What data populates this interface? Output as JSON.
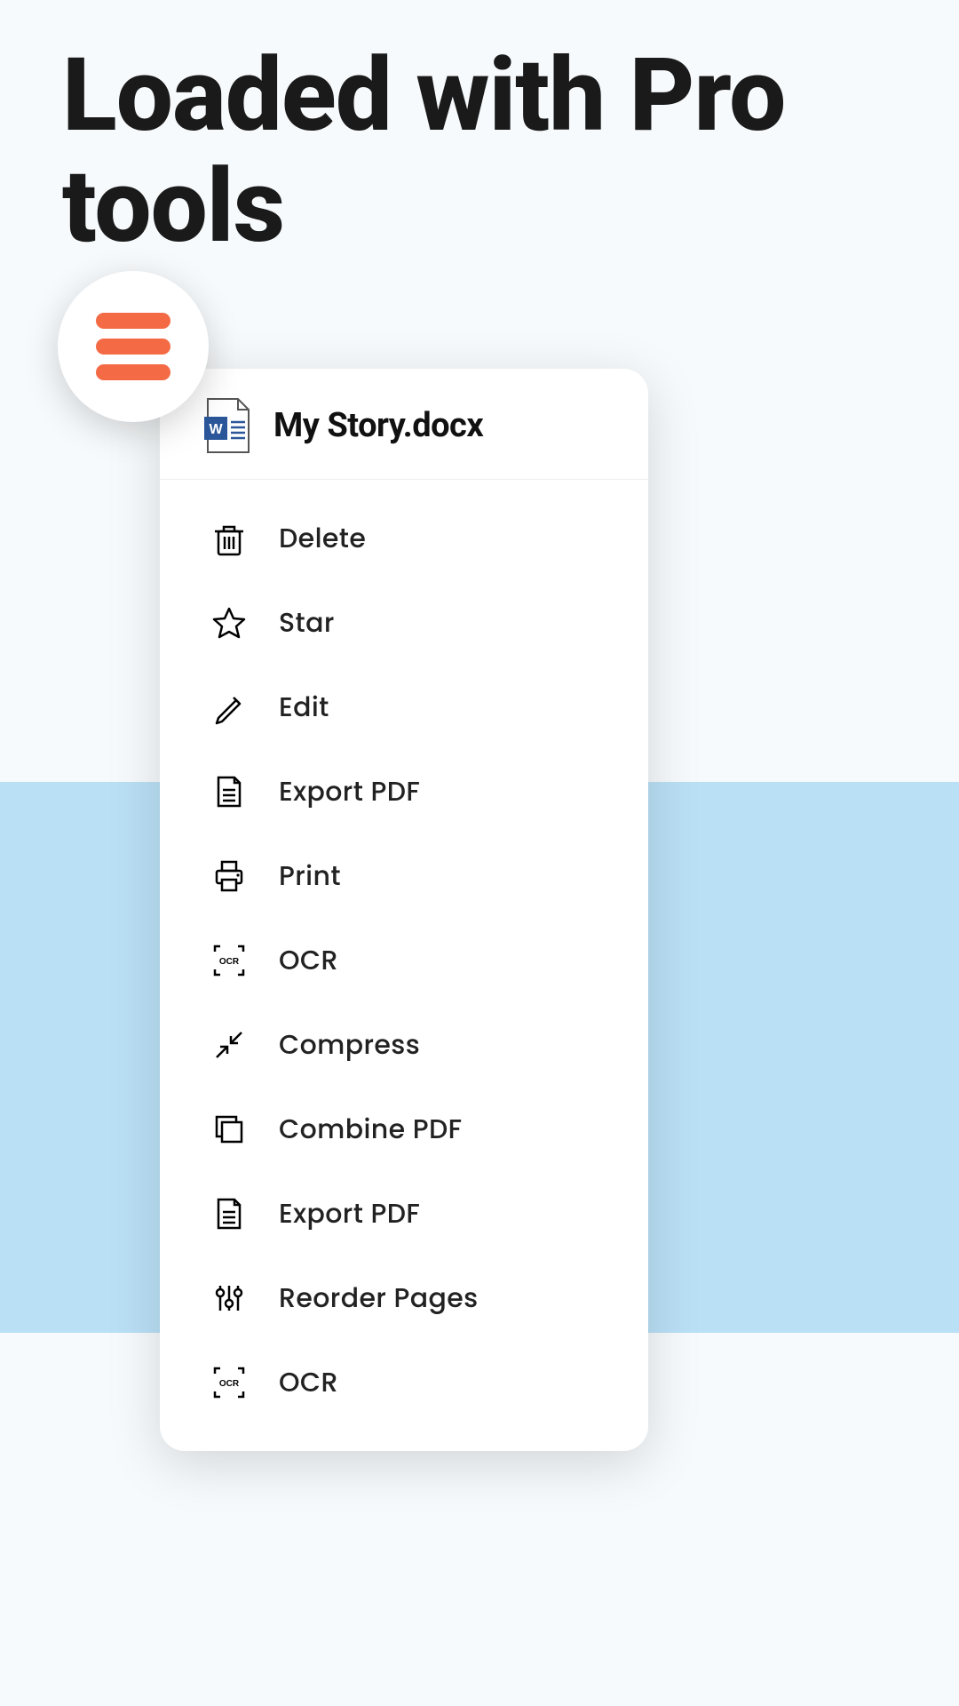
{
  "headline": "Loaded with Pro tools",
  "panel": {
    "file_name": "My Story.docx"
  },
  "actions": [
    {
      "icon": "trash-icon",
      "label": "Delete"
    },
    {
      "icon": "star-icon",
      "label": "Star"
    },
    {
      "icon": "edit-icon",
      "label": "Edit"
    },
    {
      "icon": "export-pdf-icon",
      "label": "Export PDF"
    },
    {
      "icon": "print-icon",
      "label": "Print"
    },
    {
      "icon": "ocr-icon",
      "label": "OCR"
    },
    {
      "icon": "compress-icon",
      "label": "Compress"
    },
    {
      "icon": "combine-icon",
      "label": "Combine PDF"
    },
    {
      "icon": "export-pdf-icon",
      "label": "Export PDF"
    },
    {
      "icon": "reorder-icon",
      "label": "Reorder Pages"
    },
    {
      "icon": "ocr-icon",
      "label": "OCR"
    }
  ],
  "colors": {
    "accent": "#F46A45",
    "band": "#bae0f6"
  }
}
